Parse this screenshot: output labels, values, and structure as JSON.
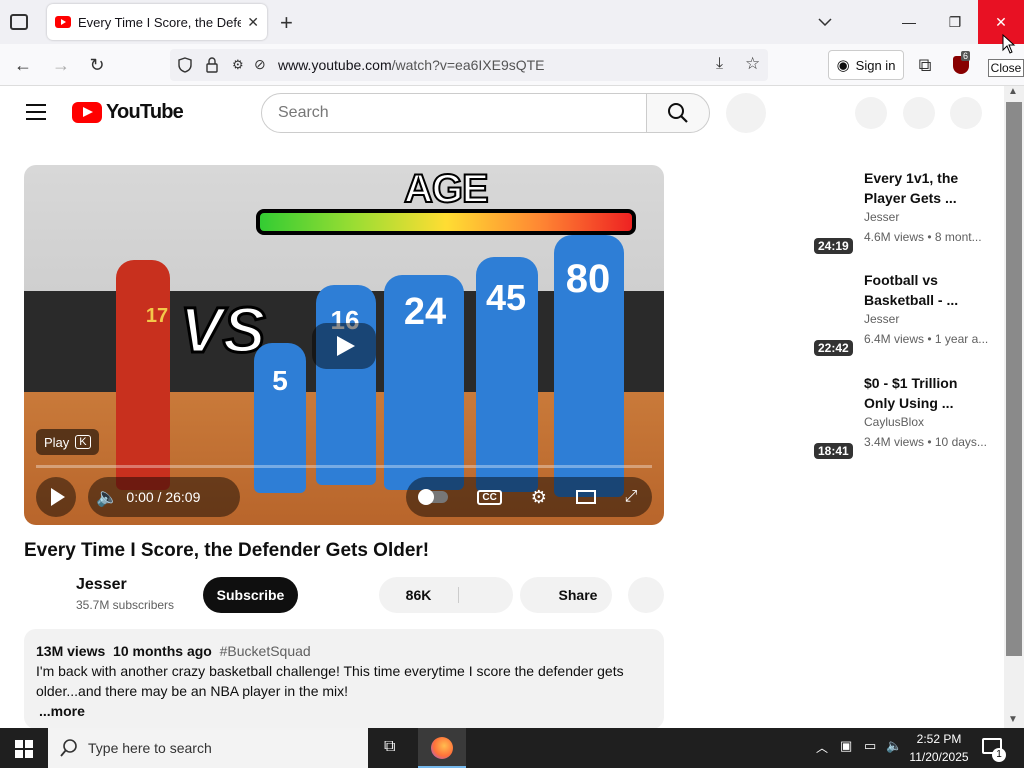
{
  "browser": {
    "tab_title": "Every Time I Score, the Defende",
    "url_host": "www.youtube.com",
    "url_path": "/watch?v=ea6IXE9sQTE",
    "signin_label": "Sign in",
    "tooltip": "Close",
    "extension_badge": "6"
  },
  "youtube": {
    "logo_text": "YouTube",
    "search_placeholder": "Search"
  },
  "video": {
    "overlay_top_text": "AGE",
    "overlay_vs_text": "VS",
    "jerseys": [
      "17",
      "5",
      "16",
      "24",
      "45",
      "80"
    ],
    "play_hint": "Play",
    "play_hint_key": "K",
    "time": "0:00 / 26:09",
    "cc_label": "CC",
    "progress": 0.0
  },
  "meta": {
    "title": "Every Time I Score, the Defender Gets Older!",
    "channel": "Jesser",
    "subscribers": "35.7M subscribers",
    "subscribe_label": "Subscribe",
    "likes": "86K",
    "share_label": "Share",
    "views": "13M views",
    "age": "10 months ago",
    "hashtag": "#BucketSquad",
    "description": "I'm back with another crazy basketball challenge! This time everytime I score the defender gets older...and there may be an NBA player in the mix!",
    "more_label": "...more"
  },
  "recommendations": [
    {
      "title": "Every 1v1, the Player Gets ...",
      "channel": "Jesser",
      "meta": "4.6M views • 8 mont...",
      "duration": "24:19"
    },
    {
      "title": "Football vs Basketball - ...",
      "channel": "Jesser",
      "meta": "6.4M views • 1 year a...",
      "duration": "22:42"
    },
    {
      "title": "$0 - $1 Trillion Only Using ...",
      "channel": "CaylusBlox",
      "meta": "3.4M views • 10 days...",
      "duration": "18:41"
    }
  ],
  "taskbar": {
    "search_placeholder": "Type here to search",
    "time": "2:52 PM",
    "date": "11/20/2025",
    "notification_count": "1"
  },
  "colors": {
    "brand_red": "#ff0000",
    "close_hover": "#e81123"
  }
}
